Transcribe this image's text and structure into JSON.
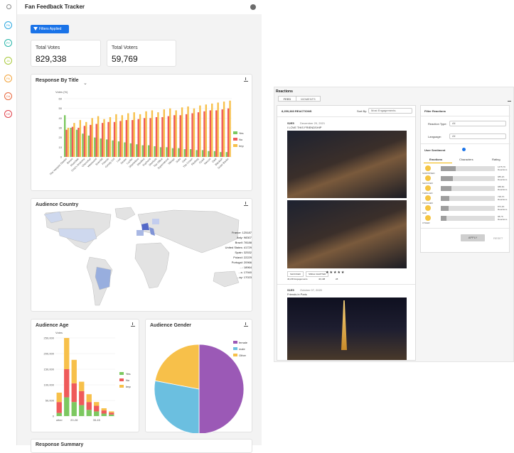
{
  "app": {
    "title": "Fan Feedback Tracker"
  },
  "rail": [
    {
      "label": "PA",
      "color": "#2aa7e0"
    },
    {
      "label": "PY",
      "color": "#26b5a8"
    },
    {
      "label": "JA",
      "color": "#a8c93a"
    },
    {
      "label": "PA",
      "color": "#f2a33a"
    },
    {
      "label": "CA",
      "color": "#e8663b"
    },
    {
      "label": "CE",
      "color": "#e0404a"
    }
  ],
  "filters_label": "Filters Applied",
  "kpis": [
    {
      "label": "Total Votes",
      "value": "829,338"
    },
    {
      "label": "Total Voters",
      "value": "59,769"
    }
  ],
  "response_by_title": {
    "title": "Response By Title",
    "chart_data": {
      "type": "bar",
      "ylabel": "Votes (%)",
      "ylim": [
        0,
        60
      ],
      "yticks": [
        "0",
        "10",
        "20",
        "30",
        "40",
        "50",
        "60"
      ],
      "legend": [
        "Yes",
        "No",
        "Imp"
      ],
      "colors": [
        "#7cc860",
        "#ef5a5a",
        "#f7c04a"
      ],
      "categories": [
        "The Vampire Diaries",
        "Bones",
        "Riverdale",
        "Grey's Anatomy",
        "Chernobyl",
        "Westworld",
        "Scandal",
        "Friends",
        "Gossip Girl",
        "Lost",
        "Dexter",
        "Lucifer",
        "Shameless",
        "Manifest",
        "Euphoria",
        "Sherlock",
        "The Office",
        "Supernatural",
        "Vikings",
        "Suits",
        "Glee",
        "The Crown",
        "Fleabag",
        "Ozark",
        "Narcos",
        "Dark",
        "Blackish",
        "Outer Banks"
      ],
      "series": [
        {
          "name": "Yes",
          "values": [
            43,
            30,
            28,
            24,
            22,
            20,
            19,
            18,
            17,
            16,
            15,
            14,
            13,
            12,
            12,
            11,
            10,
            10,
            9,
            9,
            8,
            8,
            7,
            7,
            6,
            6,
            5,
            5
          ]
        },
        {
          "name": "No",
          "values": [
            28,
            31,
            30,
            32,
            33,
            34,
            35,
            36,
            36,
            37,
            38,
            38,
            39,
            40,
            40,
            41,
            41,
            42,
            43,
            43,
            44,
            45,
            46,
            47,
            48,
            48,
            49,
            50
          ]
        },
        {
          "name": "Imp",
          "values": [
            30,
            35,
            38,
            36,
            40,
            42,
            39,
            41,
            44,
            43,
            45,
            46,
            44,
            47,
            48,
            46,
            49,
            50,
            48,
            51,
            52,
            50,
            53,
            54,
            55,
            56,
            57,
            58
          ]
        }
      ]
    }
  },
  "audience_country": {
    "title": "Audience Country",
    "countries": [
      {
        "label": "France: 125187"
      },
      {
        "label": "Italy: 98307"
      },
      {
        "label": "Brazil: 78188"
      },
      {
        "label": "United States: 41729"
      },
      {
        "label": "Spain: 32532"
      },
      {
        "label": "Poland: 22229"
      },
      {
        "label": "Portugal: 20966"
      },
      {
        "label": "...: 18964"
      },
      {
        "label": "...s: 17940"
      },
      {
        "label": "...ay: 17023"
      }
    ]
  },
  "audience_age": {
    "title": "Audience Age",
    "chart_data": {
      "type": "bar",
      "ylabel": "Votes",
      "yticks": [
        "0",
        "50,000",
        "100,000",
        "150,000",
        "200,000",
        "250,000"
      ],
      "ylim": [
        0,
        250000
      ],
      "categories": [
        "other",
        "",
        "20-28",
        "",
        "",
        "35-45",
        "",
        ""
      ],
      "legend": [
        "Yes",
        "No",
        "Imp"
      ],
      "colors": [
        "#7cc860",
        "#ef5a5a",
        "#f7c04a"
      ],
      "series": [
        {
          "name": "Yes",
          "values": [
            10000,
            60000,
            45000,
            35000,
            20000,
            15000,
            8000,
            5000
          ]
        },
        {
          "name": "No",
          "values": [
            35000,
            90000,
            60000,
            45000,
            25000,
            18000,
            10000,
            6000
          ]
        },
        {
          "name": "Imp",
          "values": [
            30000,
            100000,
            75000,
            30000,
            25000,
            12000,
            7000,
            4000
          ]
        }
      ]
    }
  },
  "audience_gender": {
    "title": "Audience Gender",
    "chart_data": {
      "type": "pie",
      "legend": [
        "female",
        "male",
        "Other"
      ],
      "colors": [
        "#9b59b6",
        "#6bbfe0",
        "#f7c04a"
      ],
      "values": [
        50,
        28,
        22
      ]
    }
  },
  "next_card_title": "Response Summary",
  "reactions": {
    "title": "Reactions",
    "tabs": [
      "FEED",
      "MOMENTS"
    ],
    "count_label": "8,259,383 REACTIONS",
    "sort_label": "Sort By:",
    "sort_value": "Most Engagements",
    "posts": [
      {
        "episode": "S2E5",
        "date": "December 29, 2021",
        "caption": "I LOVE THIS FRIENDSHIP",
        "tags": [
          "SHOCKED",
          "SMILE CHAPTER"
        ],
        "engagement": "46,245 Engagements",
        "likes": "46,198",
        "comments": "28"
      },
      {
        "episode": "S1E5",
        "date": "October 07, 2020",
        "caption": "Friends in Paris"
      }
    ],
    "filter": {
      "title": "Filter Reactions",
      "reaction_type_label": "Reaction Type:",
      "reaction_type_value": "All",
      "language_label": "Language:",
      "language_value": "All",
      "sentiment_label": "User Sentiment",
      "sentiment_tabs": [
        "Emotions",
        "Characters",
        "Rating"
      ],
      "emotions": [
        {
          "name": "SURPRISED",
          "fill": 0.28,
          "count": "1475,7K Reactions"
        },
        {
          "name": "SHOCKED",
          "fill": 0.22,
          "count": "985,2K Reactions"
        },
        {
          "name": "THRILLED",
          "fill": 0.2,
          "count": "988,6K Reactions"
        },
        {
          "name": "TOUCHED",
          "fill": 0.16,
          "count": "738,7K Reactions"
        },
        {
          "name": "SAD",
          "fill": 0.14,
          "count": "873,3K Reactions"
        },
        {
          "name": "OTHER",
          "fill": 0.1,
          "count": "98,7K Reactions"
        }
      ],
      "apply_label": "APPLY",
      "reset_label": "RESET"
    }
  }
}
